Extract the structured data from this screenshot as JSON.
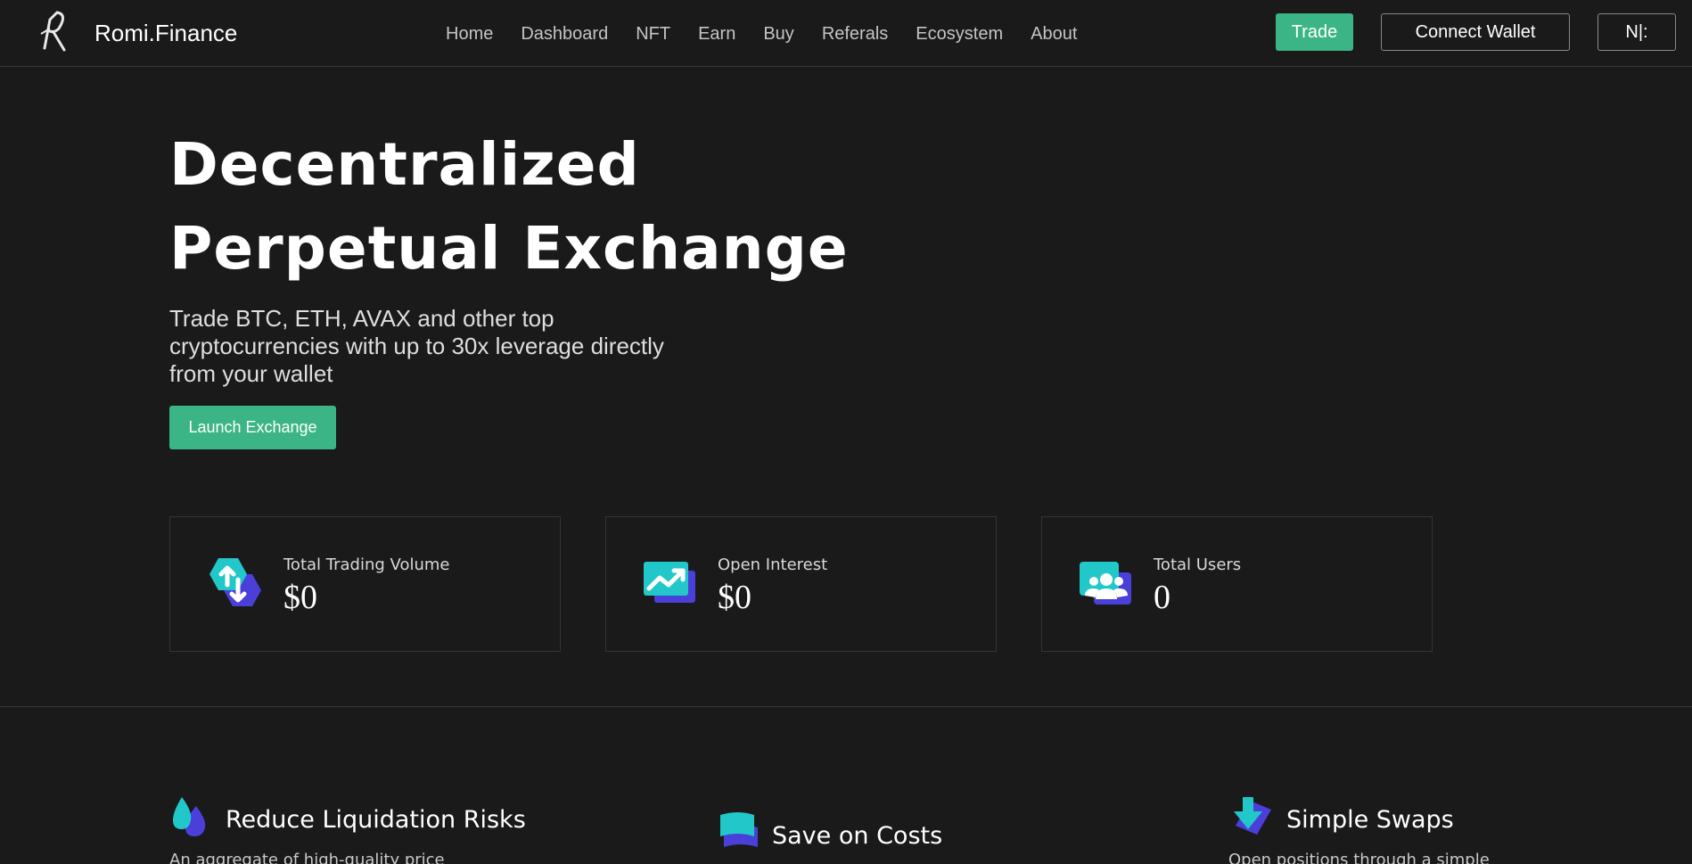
{
  "header": {
    "brand": "Romi.Finance",
    "nav": [
      "Home",
      "Dashboard",
      "NFT",
      "Earn",
      "Buy",
      "Referals",
      "Ecosystem",
      "About"
    ],
    "trade_label": "Trade",
    "connect_wallet_label": "Connect Wallet",
    "language_label": "N|:"
  },
  "hero": {
    "title_line1": "Decentralized",
    "title_line2": "Perpetual Exchange",
    "subtitle": "Trade BTC, ETH, AVAX and other top cryptocurrencies with up to 30x leverage directly from your wallet",
    "launch_label": "Launch Exchange"
  },
  "stats": [
    {
      "label": "Total Trading Volume",
      "value": "$0",
      "icon": "trading-volume-icon"
    },
    {
      "label": "Open Interest",
      "value": "$0",
      "icon": "open-interest-icon"
    },
    {
      "label": "Total Users",
      "value": "0",
      "icon": "users-icon"
    }
  ],
  "features": [
    {
      "title": "Reduce Liquidation Risks",
      "desc": "An aggregate of high-quality price",
      "icon": "droplets-icon"
    },
    {
      "title": "Save on Costs",
      "desc": "",
      "icon": "layers-icon"
    },
    {
      "title": "Simple Swaps",
      "desc": "Open positions through a simple",
      "icon": "swap-arrow-icon"
    }
  ],
  "colors": {
    "background": "#1a1a1a",
    "accent_green": "#3bb585",
    "icon_teal": "#22c7c9",
    "icon_indigo": "#4a3fd8"
  }
}
